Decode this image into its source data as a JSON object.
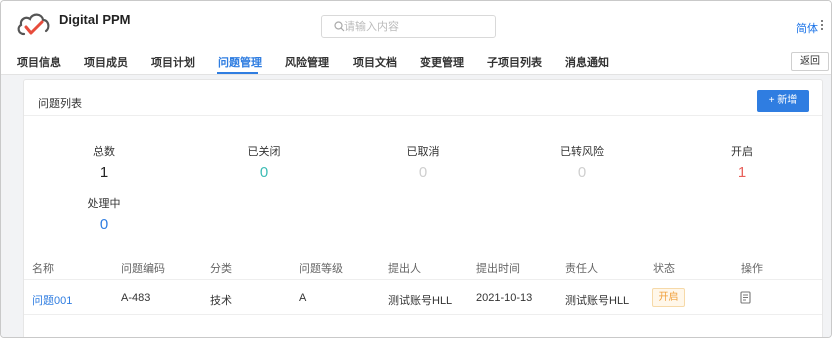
{
  "app": {
    "title": "Digital PPM"
  },
  "search": {
    "placeholder": "请输入内容",
    "value": ""
  },
  "header": {
    "language": "简体"
  },
  "nav": {
    "tabs": [
      {
        "label": "项目信息"
      },
      {
        "label": "项目成员"
      },
      {
        "label": "项目计划"
      },
      {
        "label": "问题管理",
        "active": true
      },
      {
        "label": "风险管理"
      },
      {
        "label": "项目文档"
      },
      {
        "label": "变更管理"
      },
      {
        "label": "子项目列表"
      },
      {
        "label": "消息通知"
      }
    ],
    "back_label": "返回"
  },
  "panel": {
    "title": "问题列表",
    "add_label": "+ 新增"
  },
  "stats": [
    {
      "label": "总数",
      "value": "1",
      "color": "#222222"
    },
    {
      "label": "已关闭",
      "value": "0",
      "color": "#3cbcb4"
    },
    {
      "label": "已取消",
      "value": "0",
      "color": "#cfcfcf"
    },
    {
      "label": "已转风险",
      "value": "0",
      "color": "#cfcfcf"
    },
    {
      "label": "开启",
      "value": "1",
      "color": "#e8605a"
    },
    {
      "label": "处理中",
      "value": "0",
      "color": "#2f7de1"
    }
  ],
  "table": {
    "columns": [
      "名称",
      "问题编码",
      "分类",
      "问题等级",
      "提出人",
      "提出时间",
      "责任人",
      "状态",
      "操作"
    ],
    "rows": [
      {
        "name": "问题001",
        "code": "A-483",
        "category": "技术",
        "level": "A",
        "proposer": "测试账号HLL",
        "date": "2021-10-13",
        "owner": "测试账号HLL",
        "status": "开启",
        "action_icon": "edit-icon"
      }
    ]
  },
  "colors": {
    "accent": "#2f7de1",
    "status_open_bg": "#fff7ea",
    "status_open_text": "#f0a03c"
  }
}
